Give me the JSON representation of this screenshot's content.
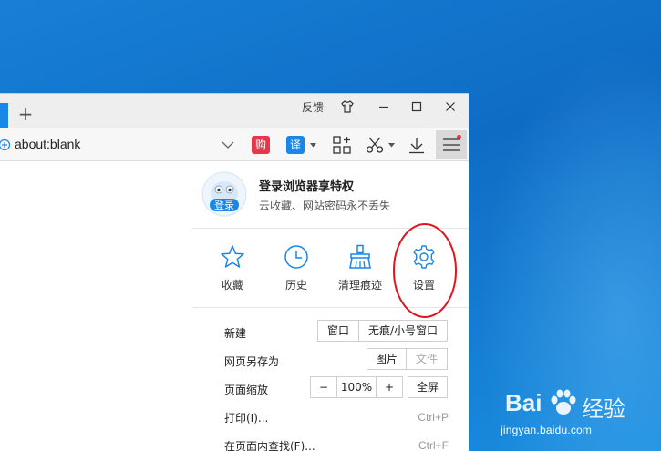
{
  "window": {
    "feedback_label": "反馈",
    "new_tab_glyph": "+"
  },
  "toolbar": {
    "address": "about:blank",
    "shopping_label": "购",
    "translate_label": "译"
  },
  "menu": {
    "login": {
      "avatar_label": "登录",
      "title": "登录浏览器享特权",
      "subtitle": "云收藏、网站密码永不丢失"
    },
    "quick_actions": [
      {
        "label": "收藏",
        "icon": "star-icon"
      },
      {
        "label": "历史",
        "icon": "clock-icon"
      },
      {
        "label": "清理痕迹",
        "icon": "broom-icon"
      },
      {
        "label": "设置",
        "icon": "gear-icon"
      }
    ],
    "rows": {
      "new": {
        "label": "新建",
        "btn_window": "窗口",
        "btn_incognito": "无痕/小号窗口"
      },
      "save_as": {
        "label": "网页另存为",
        "btn_image": "图片",
        "btn_file": "文件"
      },
      "zoom": {
        "label": "页面缩放",
        "minus": "−",
        "value": "100%",
        "plus": "+",
        "fullscreen": "全屏"
      },
      "print": {
        "label": "打印(I)...",
        "shortcut": "Ctrl+P"
      },
      "find": {
        "label": "在页面内查找(F)...",
        "shortcut": "Ctrl+F"
      }
    }
  },
  "watermark": {
    "brand_left": "Bai",
    "brand_right": "经验",
    "url": "jingyan.baidu.com"
  },
  "colors": {
    "accent": "#1a86e8",
    "annotation": "#e0141e",
    "desktop": "#1478d0"
  }
}
